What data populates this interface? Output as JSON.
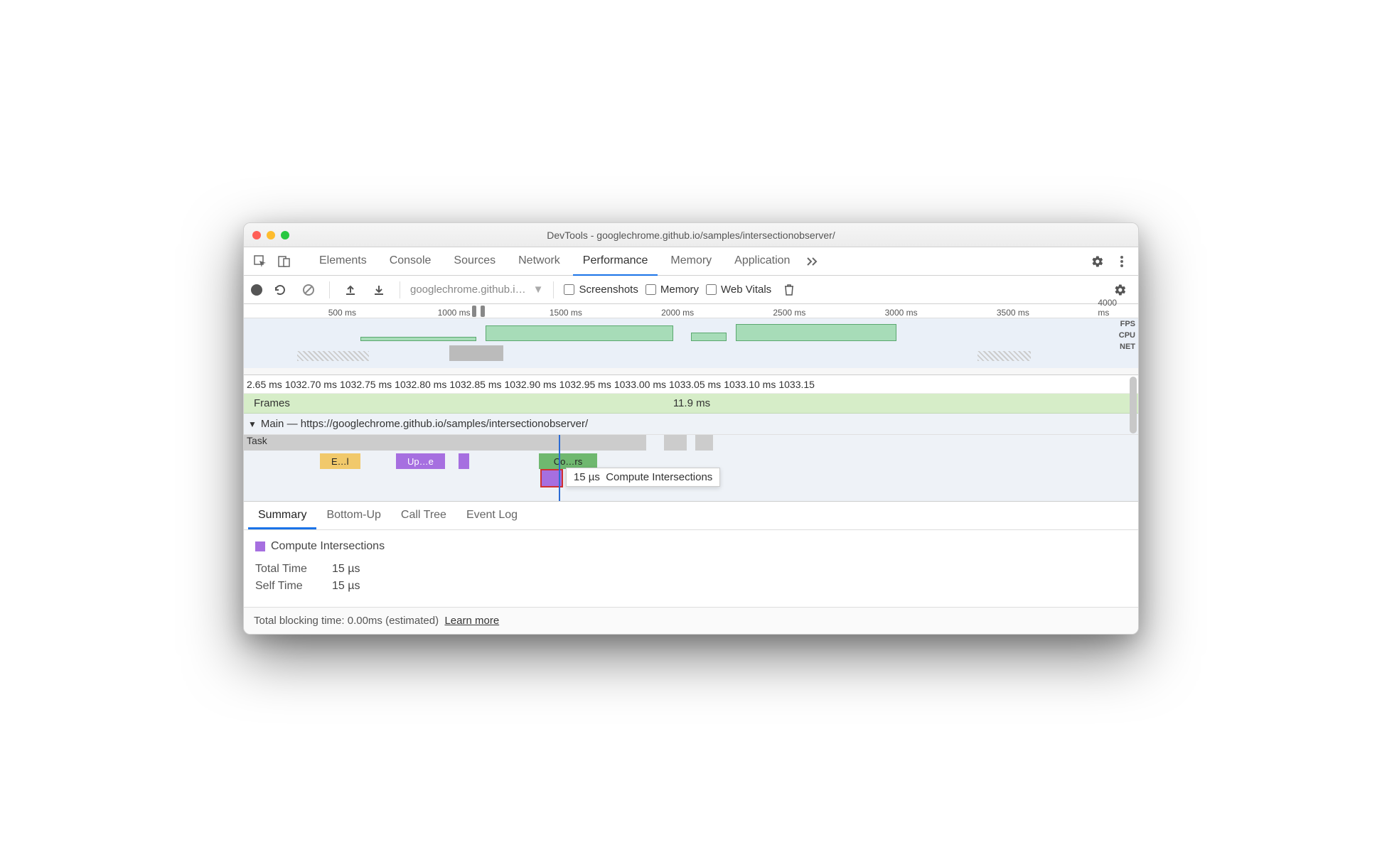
{
  "window": {
    "title": "DevTools - googlechrome.github.io/samples/intersectionobserver/"
  },
  "tabs": {
    "items": [
      "Elements",
      "Console",
      "Sources",
      "Network",
      "Performance",
      "Memory",
      "Application"
    ],
    "active": "Performance",
    "overflow_icon": "chevrons-right"
  },
  "toolbar": {
    "url": "googlechrome.github.i…",
    "screenshots_label": "Screenshots",
    "memory_label": "Memory",
    "webvitals_label": "Web Vitals"
  },
  "overview": {
    "ticks": [
      "500 ms",
      "1000 ms",
      "1500 ms",
      "2000 ms",
      "2500 ms",
      "3000 ms",
      "3500 ms",
      "4000 ms"
    ],
    "labels": {
      "fps": "FPS",
      "cpu": "CPU",
      "net": "NET"
    }
  },
  "flame": {
    "ruler": [
      "2.65 ms",
      "1032.70 ms",
      "1032.75 ms",
      "1032.80 ms",
      "1032.85 ms",
      "1032.90 ms",
      "1032.95 ms",
      "1033.00 ms",
      "1033.05 ms",
      "1033.10 ms",
      "1033.15"
    ],
    "frames_label": "Frames",
    "frames_value": "11.9 ms",
    "main_label": "Main — https://googlechrome.github.io/samples/intersectionobserver/",
    "task_label": "Task",
    "blocks": {
      "e": "E…l",
      "up": "Up…e",
      "co": "Co…rs"
    },
    "tooltip_time": "15 µs",
    "tooltip_name": "Compute Intersections"
  },
  "bottom_tabs": {
    "items": [
      "Summary",
      "Bottom-Up",
      "Call Tree",
      "Event Log"
    ],
    "active": "Summary"
  },
  "summary": {
    "name": "Compute Intersections",
    "rows": [
      {
        "k": "Total Time",
        "v": "15 µs"
      },
      {
        "k": "Self Time",
        "v": "15 µs"
      }
    ]
  },
  "footer": {
    "text": "Total blocking time: 0.00ms (estimated)",
    "link": "Learn more"
  }
}
